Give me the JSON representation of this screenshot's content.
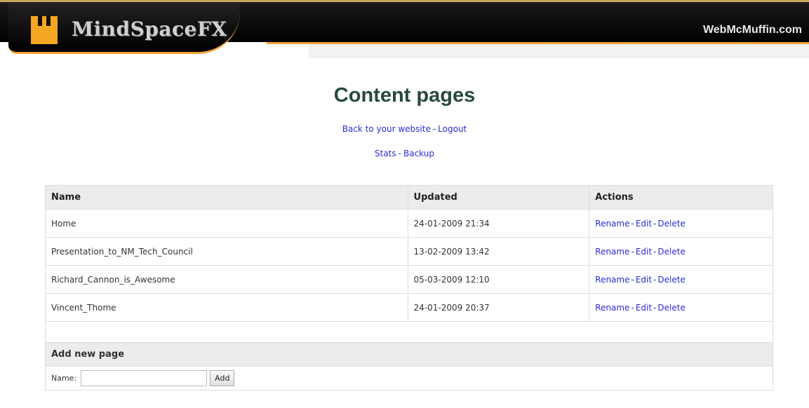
{
  "header": {
    "logo_text": "MindSpaceFX",
    "site_link": "WebMcMuffin.com"
  },
  "page": {
    "title": "Content pages"
  },
  "nav": {
    "back_label": "Back to your website",
    "logout_label": "Logout",
    "stats_label": "Stats",
    "backup_label": "Backup",
    "separator": "-"
  },
  "table": {
    "columns": [
      "Name",
      "Updated",
      "Actions"
    ],
    "rows": [
      {
        "name": "Home",
        "updated": "24-01-2009 21:34"
      },
      {
        "name": "Presentation_to_NM_Tech_Council",
        "updated": "13-02-2009 13:42"
      },
      {
        "name": "Richard_Cannon_is_Awesome",
        "updated": "05-03-2009 12:10"
      },
      {
        "name": "Vincent_Thome",
        "updated": "24-01-2009 20:37"
      }
    ],
    "actions": {
      "rename": "Rename",
      "edit": "Edit",
      "delete": "Delete"
    }
  },
  "add_page": {
    "heading": "Add new page",
    "name_label": "Name:",
    "input_value": "",
    "button_label": "Add"
  },
  "colors": {
    "title": "#274a3c",
    "link": "#2b2bd8",
    "accent": "#f0a23a"
  }
}
